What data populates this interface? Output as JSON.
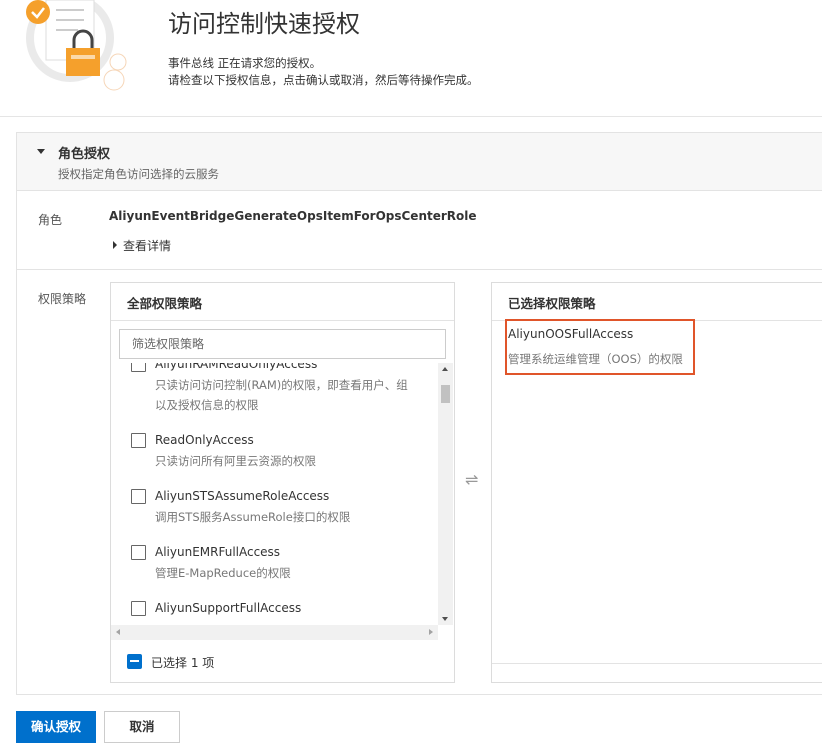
{
  "header": {
    "title": "访问控制快速授权",
    "desc_line1": "事件总线 正在请求您的授权。",
    "desc_line2": "请检查以下授权信息，点击确认或取消，然后等待操作完成。"
  },
  "role_section": {
    "title": "角色授权",
    "subtitle": "授权指定角色访问选择的云服务",
    "role_label": "角色",
    "role_name": "AliyunEventBridgeGenerateOpsItemForOpsCenterRole",
    "view_details": "查看详情",
    "policy_label": "权限策略"
  },
  "all_policies": {
    "title": "全部权限策略",
    "search_placeholder": "筛选权限策略",
    "items": [
      {
        "name": "AliyunRAMReadOnlyAccess",
        "desc": "只读访问访问控制(RAM)的权限，即查看用户、组",
        "desc2": "以及授权信息的权限"
      },
      {
        "name": "ReadOnlyAccess",
        "desc": "只读访问所有阿里云资源的权限"
      },
      {
        "name": "AliyunSTSAssumeRoleAccess",
        "desc": "调用STS服务AssumeRole接口的权限"
      },
      {
        "name": "AliyunEMRFullAccess",
        "desc": "管理E-MapReduce的权限"
      },
      {
        "name": "AliyunSupportFullAccess",
        "desc": ""
      }
    ],
    "selected_count_label": "已选择 1 项"
  },
  "selected_policies": {
    "title": "已选择权限策略",
    "items": [
      {
        "name": "AliyunOOSFullAccess",
        "desc": "管理系统运维管理（OOS）的权限"
      }
    ]
  },
  "transfer_icon": "⇌",
  "buttons": {
    "confirm": "确认授权",
    "cancel": "取消"
  },
  "colors": {
    "primary": "#0070cc",
    "highlight": "#e0552a",
    "logo_orange": "#f5a02c"
  }
}
